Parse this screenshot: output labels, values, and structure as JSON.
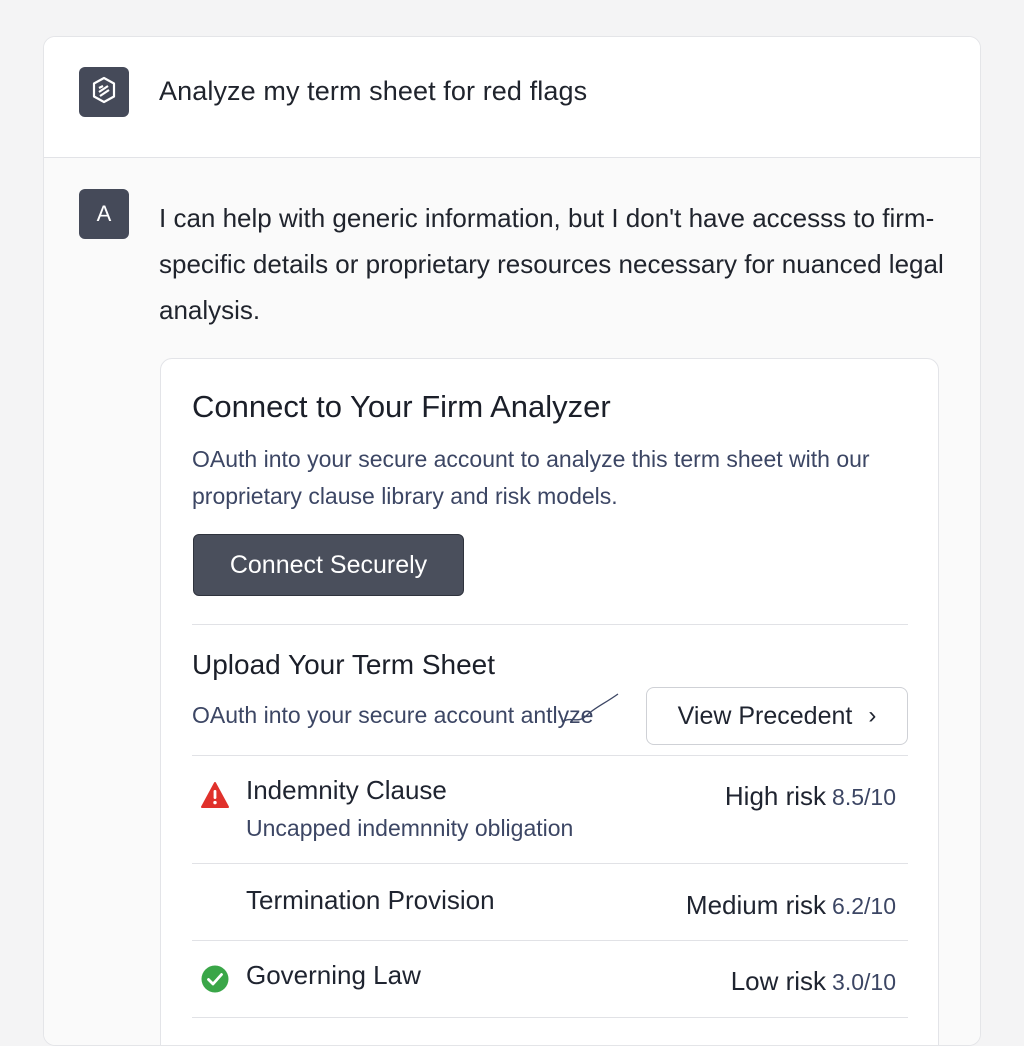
{
  "user_message": {
    "avatar_icon": "openai-logo-icon",
    "text": "Analyze my term sheet for red flags"
  },
  "assistant_message": {
    "avatar_letter": "A",
    "text": "I can help with generic information, but I don't have accesss to firm-specific details or proprietary resources necessary for nuanced legal analysis."
  },
  "card": {
    "title": "Connect to Your Firm Analyzer",
    "description": "OAuth into your secure account to analyze this term sheet with our proprietary clause library and risk models.",
    "connect_button": "Connect Securely",
    "upload_title": "Upload Your Term Sheet",
    "upload_subtitle": "OAuth into your secure account antlyze",
    "view_precedent_button": "View Precedent",
    "risks": [
      {
        "icon": "warning-triangle-icon",
        "name": "Indemnity Clause",
        "detail": "Uncapped indemnnity obligation",
        "level": "High risk",
        "score": "8.5/10"
      },
      {
        "icon": "",
        "name": "Termination Provision",
        "detail": "",
        "level": "Medium risk",
        "score": "6.2/10"
      },
      {
        "icon": "check-circle-icon",
        "name": "Governing Law",
        "detail": "",
        "level": "Low risk",
        "score": "3.0/10"
      }
    ]
  },
  "colors": {
    "avatar_bg": "#454a59",
    "button_dark": "#4a4f5c",
    "warning_red": "#e0312b",
    "success_green": "#3aa648"
  }
}
